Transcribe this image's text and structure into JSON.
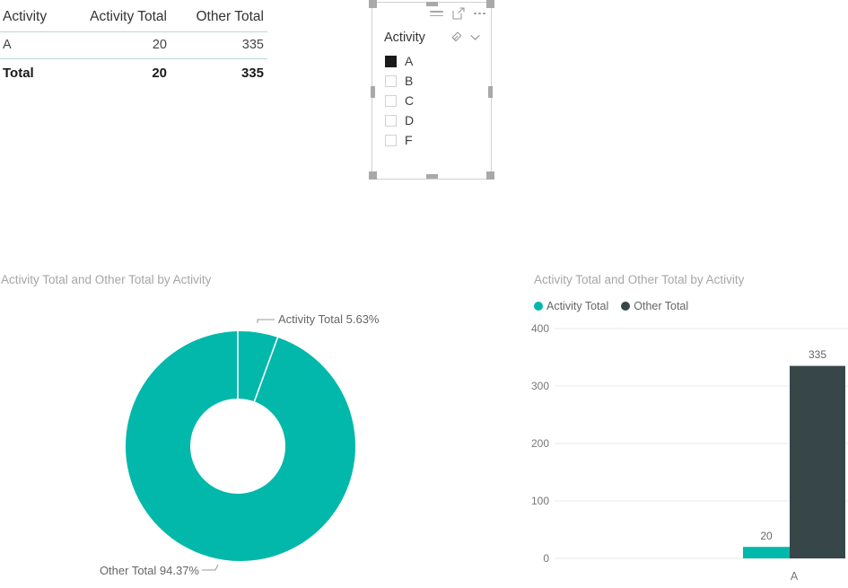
{
  "colors": {
    "accent_teal": "#01b8aa",
    "dark_slate": "#374649",
    "rule": "#b9d7da",
    "muted_text": "#a6a6a6",
    "axis_text": "#777777"
  },
  "table_visual": {
    "name": "activity-table",
    "columns": [
      "Activity",
      "Activity Total",
      "Other Total"
    ],
    "rows": [
      {
        "activity": "A",
        "activity_total": "20",
        "other_total": "335"
      }
    ],
    "total_row": {
      "label": "Total",
      "activity_total": "20",
      "other_total": "335"
    }
  },
  "slicer_visual": {
    "title": "Activity",
    "toolbar": {
      "filter_icon": "hamburger-filter-icon",
      "focus_icon": "focus-mode-icon",
      "more_icon": "more-options-icon"
    },
    "header_icons": {
      "clear_icon": "eraser-clear-selections-icon",
      "expand_icon": "chevron-down-icon"
    },
    "items": [
      {
        "label": "A",
        "checked": true
      },
      {
        "label": "B",
        "checked": false
      },
      {
        "label": "C",
        "checked": false
      },
      {
        "label": "D",
        "checked": false
      },
      {
        "label": "F",
        "checked": false
      }
    ]
  },
  "donut_visual": {
    "title": "Activity Total and Other Total by Activity",
    "callouts": {
      "top": "Activity Total 5.63%",
      "bottom": "Other Total 94.37%"
    }
  },
  "bar_visual": {
    "title": "Activity Total and Other Total by Activity",
    "legend": [
      {
        "label": "Activity Total",
        "color": "#01b8aa"
      },
      {
        "label": "Other Total",
        "color": "#374649"
      }
    ]
  },
  "chart_data": [
    {
      "type": "pie",
      "subtype": "donut",
      "title": "Activity Total and Other Total by Activity",
      "labels": [
        "Activity Total",
        "Other Total"
      ],
      "values": [
        20,
        335
      ],
      "percentages": [
        5.63,
        94.37
      ],
      "display_labels": [
        "Activity Total 5.63%",
        "Other Total 94.37%"
      ],
      "colors": [
        "#01b8aa",
        "#01b8aa"
      ],
      "legend": "none",
      "note": "Both slices rendered in the same teal; separated by white gaps"
    },
    {
      "type": "bar",
      "title": "Activity Total and Other Total by Activity",
      "categories": [
        "A"
      ],
      "series": [
        {
          "name": "Activity Total",
          "values": [
            20
          ],
          "color": "#01b8aa"
        },
        {
          "name": "Other Total",
          "values": [
            335
          ],
          "color": "#374649"
        }
      ],
      "xlabel": "",
      "ylabel": "",
      "ylim": [
        0,
        400
      ],
      "yticks": [
        0,
        100,
        200,
        300,
        400
      ],
      "ytick_labels": [
        "0",
        "100",
        "200",
        "300",
        "400"
      ],
      "data_labels": [
        "20",
        "335"
      ],
      "grid": true,
      "legend_position": "top-left"
    }
  ]
}
